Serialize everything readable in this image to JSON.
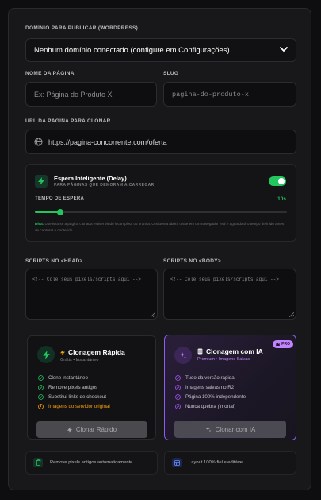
{
  "domain": {
    "label": "DOMÍNIO PARA PUBLICAR (WORDPRESS)",
    "selected": "Nenhum domínio conectado (configure em Configurações)"
  },
  "page_name": {
    "label": "NOME DA PÁGINA",
    "placeholder": "Ex: Página do Produto X"
  },
  "slug": {
    "label": "SLUG",
    "value": "pagina-do-produto-x"
  },
  "clone_url": {
    "label": "URL DA PÁGINA PARA CLONAR",
    "value": "https://pagina-concorrente.com/oferta"
  },
  "smart_wait": {
    "title": "Espera Inteligente (Delay)",
    "subtitle": "PARA PÁGINAS QUE DEMORAM A CARREGAR",
    "toggle_on": true,
    "time_label": "TEMPO DE ESPERA",
    "time_value": "10s",
    "slider_fraction": 0.1,
    "tip_prefix": "Dica:",
    "tip_text": "Use isso se a página clonada estiver vindo incompleta ou branca. O sistema abrirá o site em um navegador real e aguardará o tempo definido antes de capturar o conteúdo."
  },
  "scripts": {
    "head_label": "SCRIPTS NO <HEAD>",
    "head_placeholder": "<!-- Cole seus pixels/scripts aqui -->",
    "body_label": "SCRIPTS NO <BODY>",
    "body_placeholder": "<!-- Cole seus pixels/scripts aqui -->"
  },
  "fast_clone": {
    "title": "Clonagem Rápida",
    "subtitle": "Grátis • Instantâneo",
    "items": [
      "Clone instantâneo",
      "Remove pixels antigos",
      "Substitui links de checkout"
    ],
    "warning": "Imagens do servidor original",
    "button": "Clonar Rápido"
  },
  "ai_clone": {
    "title": "Clonagem com IA",
    "subtitle": "Premium • Imagens Salvas",
    "badge": "PRO",
    "items": [
      "Tudo da versão rápida",
      "Imagens salvas no R2",
      "Página 100% independente",
      "Nunca quebra (imortal)"
    ],
    "button": "Clonar com IA"
  },
  "footer": {
    "left": "Remove pixels antigos automaticamente",
    "right": "Layout 100% fiel e editável"
  },
  "colors": {
    "accent_green": "#22c55e",
    "accent_purple": "#a855f7",
    "warning_orange": "#f59e0b"
  }
}
